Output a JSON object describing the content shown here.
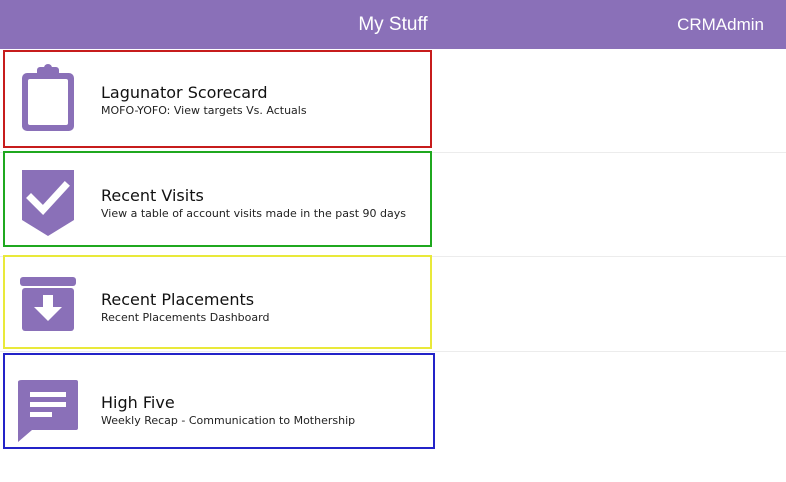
{
  "header": {
    "title": "My Stuff",
    "user": "CRMAdmin",
    "bg_color": "#8a70b8"
  },
  "items": [
    {
      "title": "Lagunator Scorecard",
      "subtitle": "MOFO-YOFO: View targets Vs. Actuals",
      "icon": "clipboard-icon",
      "outline_color": "#c71c1c"
    },
    {
      "title": "Recent Visits",
      "subtitle": "View a table of account visits made in the past 90 days",
      "icon": "checkmark-badge-icon",
      "outline_color": "#1fa81f"
    },
    {
      "title": "Recent Placements",
      "subtitle": "Recent Placements Dashboard",
      "icon": "archive-download-icon",
      "outline_color": "#e9e93a"
    },
    {
      "title": "High Five",
      "subtitle": "Weekly Recap - Communication to Mothership",
      "icon": "chat-bubble-icon",
      "outline_color": "#2323c8"
    }
  ],
  "icon_color": "#8a70b8"
}
